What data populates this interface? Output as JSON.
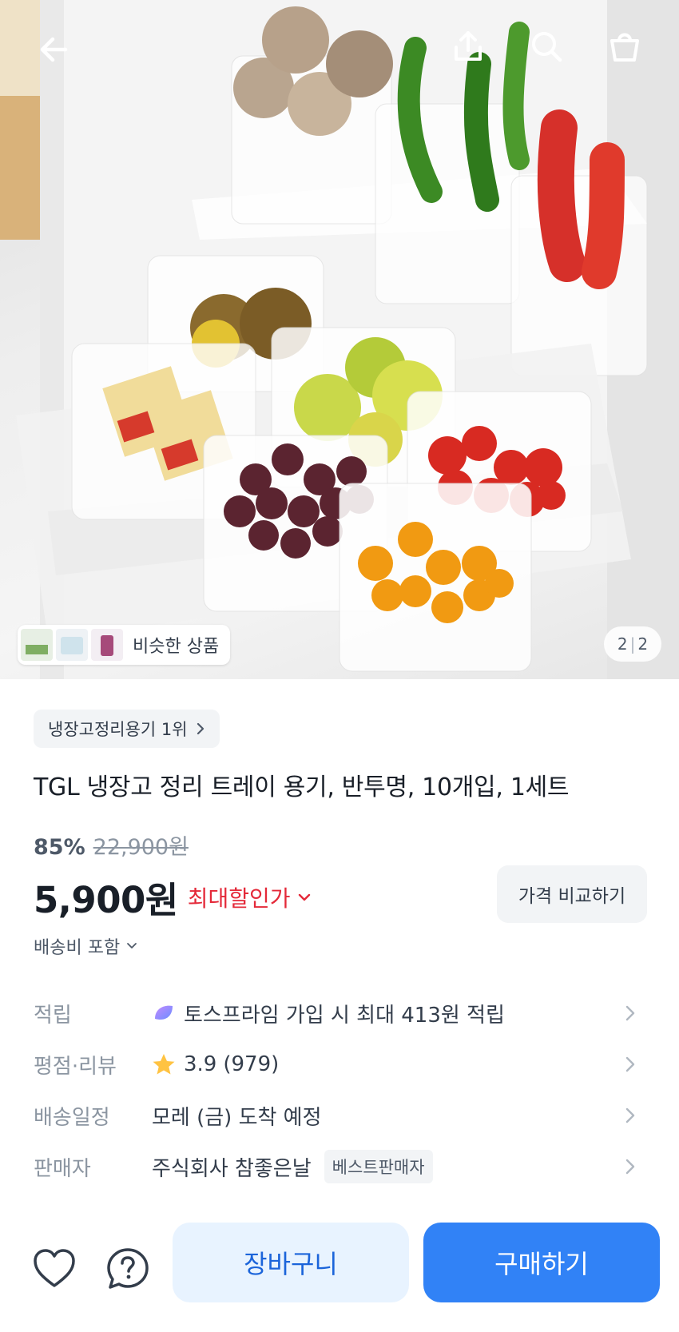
{
  "hero": {
    "similar_label": "비슷한 상품",
    "page_current": "2",
    "page_total": "2"
  },
  "icons": {
    "back": "arrow-left-icon",
    "share": "share-icon",
    "search": "search-icon",
    "cart": "shopping-bag-icon",
    "like": "heart-icon",
    "qa": "question-icon"
  },
  "product": {
    "rank_badge": "냉장고정리용기 1위",
    "title": "TGL 냉장고 정리 트레이 용기, 반투명, 10개입, 1세트",
    "discount": "85%",
    "original_price": "22,900원",
    "price": "5,900원",
    "max_discount_label": "최대할인가",
    "compare_label": "가격 비교하기",
    "shipping_fee": "배송비 포함"
  },
  "info": {
    "points": {
      "key": "적립",
      "value": "토스프라임 가입 시 최대 413원 적립"
    },
    "rating": {
      "key": "평점·리뷰",
      "score": "3.9",
      "count": "(979)",
      "stars": 3.9
    },
    "delivery": {
      "key": "배송일정",
      "value": "모레 (금) 도착 예정"
    },
    "seller": {
      "key": "판매자",
      "value": "주식회사 참좋은날",
      "badge": "베스트판매자"
    }
  },
  "actions": {
    "cart_label": "장바구니",
    "buy_label": "구매하기"
  },
  "colors": {
    "accent": "#3182f6",
    "accent_light": "#e8f3ff",
    "discount_red": "#e42939",
    "star": "#ffc342"
  }
}
